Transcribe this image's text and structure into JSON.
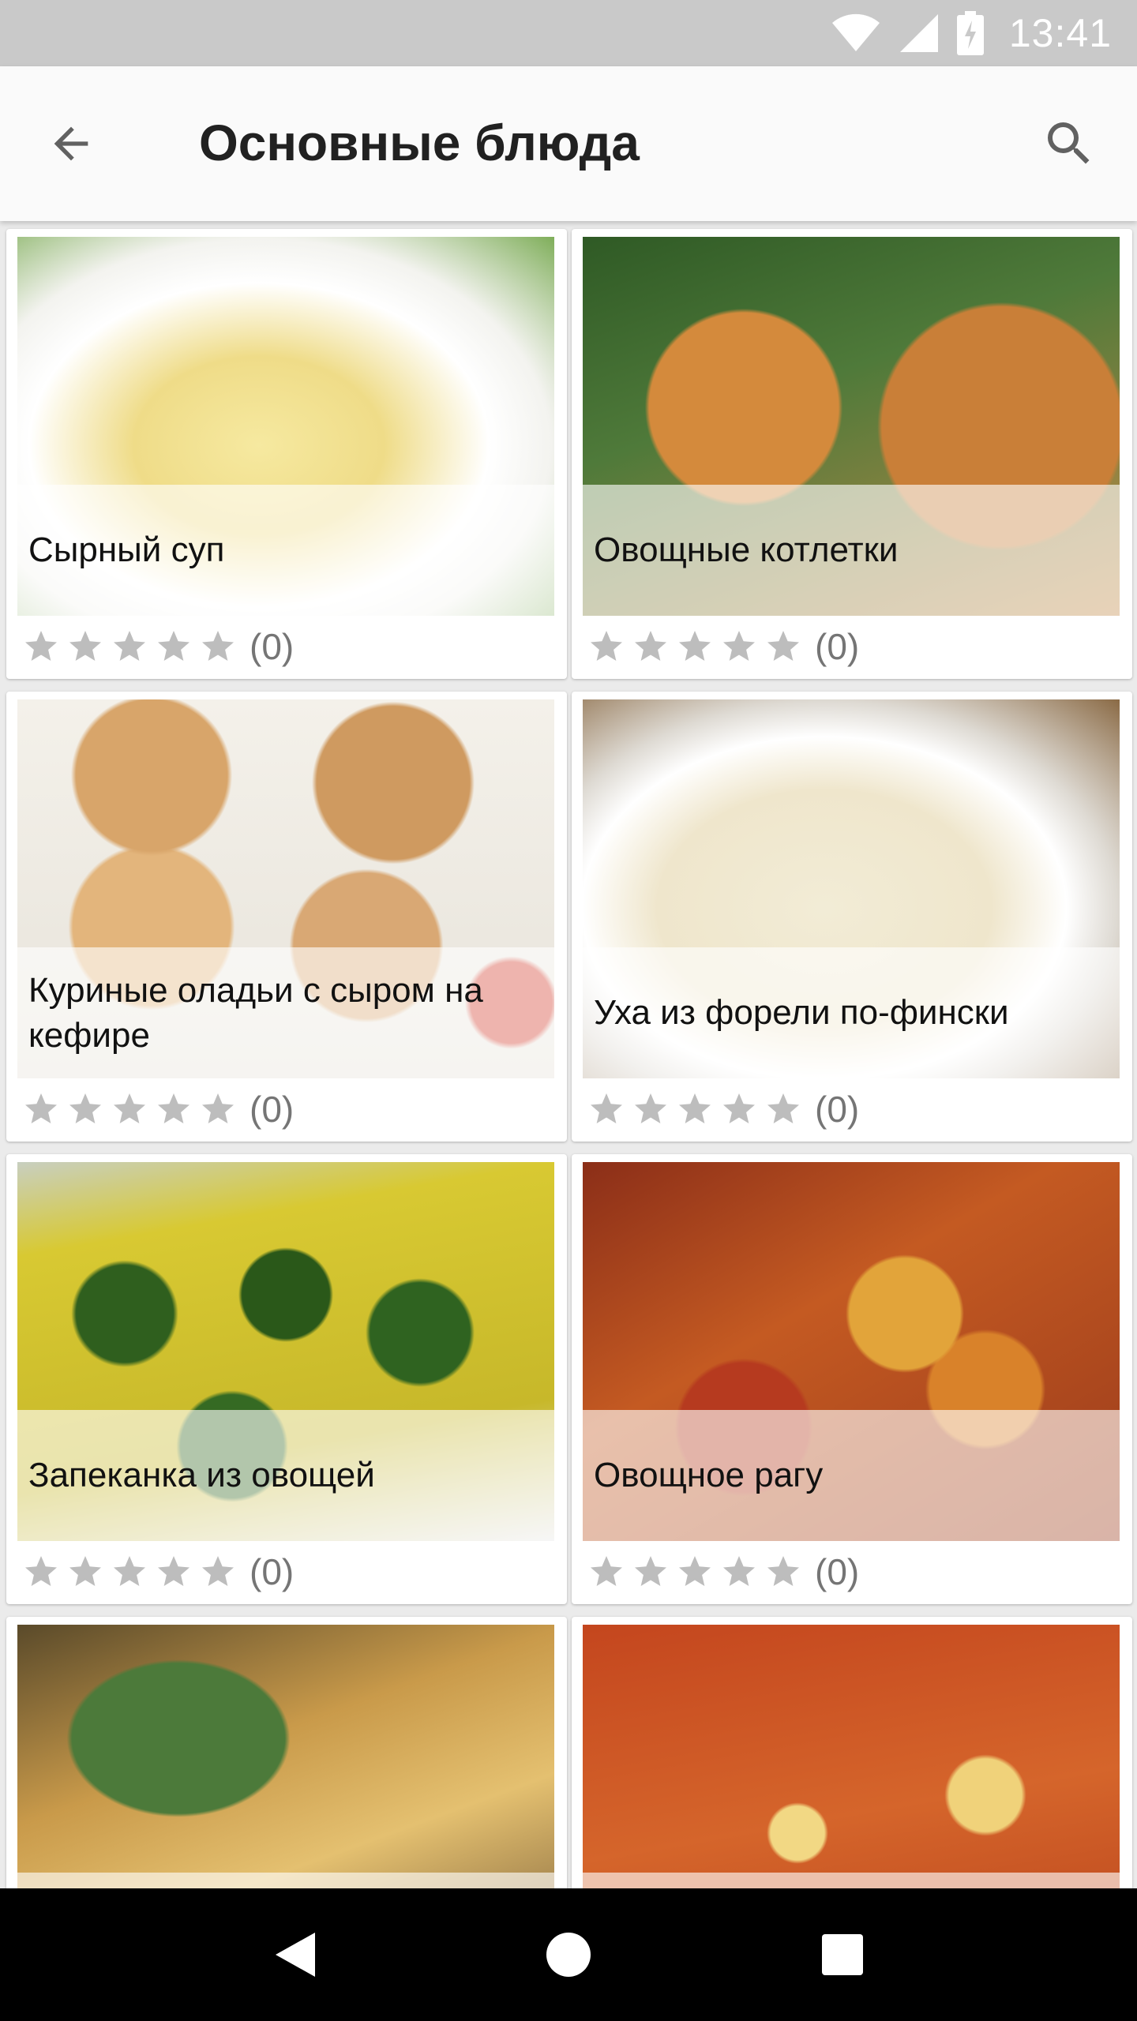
{
  "status_bar": {
    "time": "13:41",
    "icons": [
      "wifi-icon",
      "signal-icon",
      "battery-icon"
    ]
  },
  "app_bar": {
    "title": "Основные блюда",
    "back_icon": "arrow-back-icon",
    "search_icon": "search-icon"
  },
  "recipes": [
    {
      "title": "Сырный суп",
      "rating_count": "(0)",
      "stars": 0
    },
    {
      "title": "Овощные котлетки",
      "rating_count": "(0)",
      "stars": 0
    },
    {
      "title": "Куриные оладьи с сыром на кефире",
      "rating_count": "(0)",
      "stars": 0
    },
    {
      "title": "Уха из форели по-фински",
      "rating_count": "(0)",
      "stars": 0
    },
    {
      "title": "Запеканка из овощей",
      "rating_count": "(0)",
      "stars": 0
    },
    {
      "title": "Овощное рагу",
      "rating_count": "(0)",
      "stars": 0
    },
    {
      "title": "",
      "rating_count": "",
      "stars": 0
    },
    {
      "title": "",
      "rating_count": "",
      "stars": 0
    }
  ],
  "nav_bar": {
    "back": "nav-back-icon",
    "home": "nav-home-icon",
    "recents": "nav-recents-icon"
  },
  "colors": {
    "status_bar": "#c9c9c9",
    "app_bar": "#fafafa",
    "background": "#ebebeb",
    "star_empty": "#bdbdbd"
  }
}
